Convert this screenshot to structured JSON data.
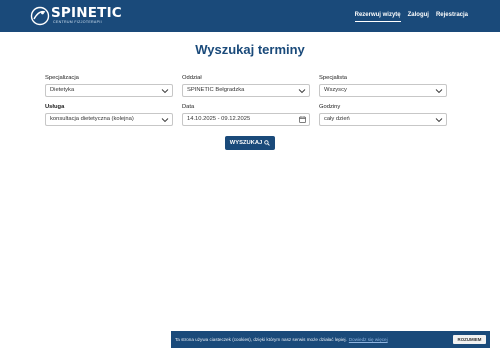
{
  "header": {
    "logo_name": "SPINETIC",
    "logo_subtitle": "CENTRUM FIZJOTERAPII",
    "nav": [
      "Rezerwuj wizytę",
      "Zaloguj",
      "Rejestracja"
    ]
  },
  "page": {
    "title": "Wyszukaj terminy"
  },
  "form": {
    "specjalizacja": {
      "label": "Specjalizacja",
      "value": "Dietetyka"
    },
    "oddzial": {
      "label": "Oddział",
      "value": "SPINETIC Bełgradzka"
    },
    "specjalista": {
      "label": "Specjalista",
      "value": "Wszyscy"
    },
    "usluga": {
      "label": "Usługa",
      "value": "konsultacja dietetyczna (kolejna)"
    },
    "data": {
      "label": "Data",
      "value": "14.10.2025 - 09.12.2025"
    },
    "godziny": {
      "label": "Godziny",
      "value": "cały dzień"
    },
    "search_label": "WYSZUKAJ"
  },
  "cookie_bar": {
    "text": "Ta strona używa ciasteczek (cookies), dzięki którym nasz serwis może działać lepiej.",
    "more": "Dowiedz się więcej",
    "accept": "ROZUMIEM"
  },
  "colors": {
    "primary": "#1a4a7a",
    "background": "#ffffff"
  }
}
